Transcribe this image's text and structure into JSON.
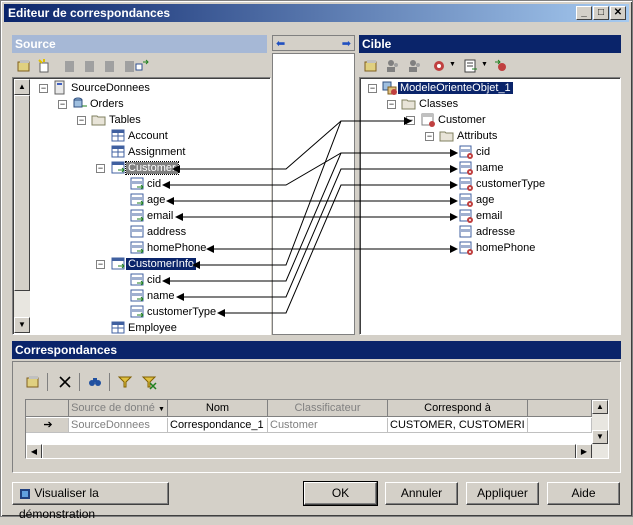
{
  "window": {
    "title": "Editeur de correspondances"
  },
  "source": {
    "header": "Source",
    "tree": [
      {
        "label": "SourceDonnees",
        "depth": 0,
        "pm": "-",
        "icon": "datasource"
      },
      {
        "label": "Orders",
        "depth": 1,
        "pm": "-",
        "icon": "database"
      },
      {
        "label": "Tables",
        "depth": 2,
        "pm": "-",
        "icon": "folder"
      },
      {
        "label": "Account",
        "depth": 3,
        "pm": "",
        "icon": "table"
      },
      {
        "label": "Assignment",
        "depth": 3,
        "pm": "",
        "icon": "table"
      },
      {
        "label": "Customer",
        "depth": 3,
        "pm": "-",
        "icon": "table-map",
        "state": "selgray"
      },
      {
        "label": "cid",
        "depth": 4,
        "pm": "",
        "icon": "column"
      },
      {
        "label": "age",
        "depth": 4,
        "pm": "",
        "icon": "column"
      },
      {
        "label": "email",
        "depth": 4,
        "pm": "",
        "icon": "column"
      },
      {
        "label": "address",
        "depth": 4,
        "pm": "",
        "icon": "column-plain"
      },
      {
        "label": "homePhone",
        "depth": 4,
        "pm": "",
        "icon": "column"
      },
      {
        "label": "CustomerInfo",
        "depth": 3,
        "pm": "-",
        "icon": "table-map",
        "state": "sel"
      },
      {
        "label": "cid",
        "depth": 4,
        "pm": "",
        "icon": "column"
      },
      {
        "label": "name",
        "depth": 4,
        "pm": "",
        "icon": "column"
      },
      {
        "label": "customerType",
        "depth": 4,
        "pm": "",
        "icon": "column"
      },
      {
        "label": "Employee",
        "depth": 3,
        "pm": "",
        "icon": "table"
      }
    ]
  },
  "target": {
    "header": "Cible",
    "tree": [
      {
        "label": "ModeleOrienteObjet_1",
        "depth": 0,
        "pm": "-",
        "icon": "model",
        "state": "sel"
      },
      {
        "label": "Classes",
        "depth": 1,
        "pm": "-",
        "icon": "folder"
      },
      {
        "label": "Customer",
        "depth": 2,
        "pm": "-",
        "icon": "class"
      },
      {
        "label": "Attributs",
        "depth": 3,
        "pm": "-",
        "icon": "folder"
      },
      {
        "label": "cid",
        "depth": 4,
        "pm": "",
        "icon": "attr"
      },
      {
        "label": "name",
        "depth": 4,
        "pm": "",
        "icon": "attr"
      },
      {
        "label": "customerType",
        "depth": 4,
        "pm": "",
        "icon": "attr"
      },
      {
        "label": "age",
        "depth": 4,
        "pm": "",
        "icon": "attr"
      },
      {
        "label": "email",
        "depth": 4,
        "pm": "",
        "icon": "attr"
      },
      {
        "label": "adresse",
        "depth": 4,
        "pm": "",
        "icon": "attr-plain"
      },
      {
        "label": "homePhone",
        "depth": 4,
        "pm": "",
        "icon": "attr"
      }
    ]
  },
  "mappings_panel": {
    "header": "Correspondances",
    "columns": [
      "Source de donné",
      "Nom",
      "Classificateur",
      "Correspond à"
    ],
    "rows": [
      {
        "marker": "➔",
        "source": "SourceDonnees",
        "name": "Correspondance_1",
        "classifier": "Customer",
        "maps_to": "CUSTOMER, CUSTOMERI"
      }
    ]
  },
  "buttons": {
    "demo": "Visualiser la démonstration",
    "ok": "OK",
    "cancel": "Annuler",
    "apply": "Appliquer",
    "help": "Aide"
  },
  "colors": {
    "title_start": "#0a246a",
    "title_end": "#a6caf0",
    "selection": "#0a246a",
    "face": "#d4d0c8"
  }
}
